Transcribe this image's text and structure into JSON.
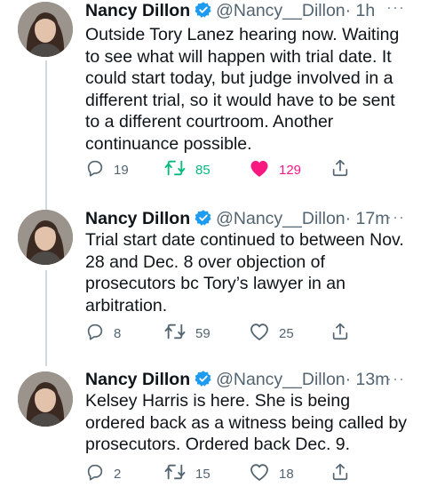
{
  "tweets": [
    {
      "author_name": "Nancy Dillon",
      "handle": "@Nancy__Dillon",
      "time": "· 1h",
      "text": "Outside Tory Lanez hearing now. Waiting to see what will happen with trial date. It could start today, but judge involved in a different trial, so it would have to be sent to a different courtroom. Another continuance possible.",
      "reply_count": "19",
      "retweet_count": "85",
      "like_count": "129",
      "liked": true,
      "retweeted": true
    },
    {
      "author_name": "Nancy Dillon",
      "handle": "@Nancy__Dillon",
      "time": "· 17m",
      "text": "Trial start date continued to between Nov. 28 and Dec. 8 over objection of prosecutors bc Tory’s lawyer in an arbitration.",
      "reply_count": "8",
      "retweet_count": "59",
      "like_count": "25",
      "liked": false,
      "retweeted": false
    },
    {
      "author_name": "Nancy Dillon",
      "handle": "@Nancy__Dillon",
      "time": "· 13m",
      "text": "Kelsey Harris is here. She is being ordered back as a witness being called by prosecutors. Ordered back Dec. 9.",
      "reply_count": "2",
      "retweet_count": "15",
      "like_count": "18",
      "liked": false,
      "retweeted": false
    }
  ],
  "more_symbol": "···",
  "icons": [
    "verified-badge-icon",
    "reply-icon",
    "retweet-icon",
    "like-icon",
    "share-icon",
    "more-icon"
  ],
  "colors": {
    "verified": "#1d9bf0",
    "like_active": "#f91880",
    "retweet_active": "#00ba7c",
    "secondary_text": "#536471",
    "thread_line": "#cfd9de"
  }
}
